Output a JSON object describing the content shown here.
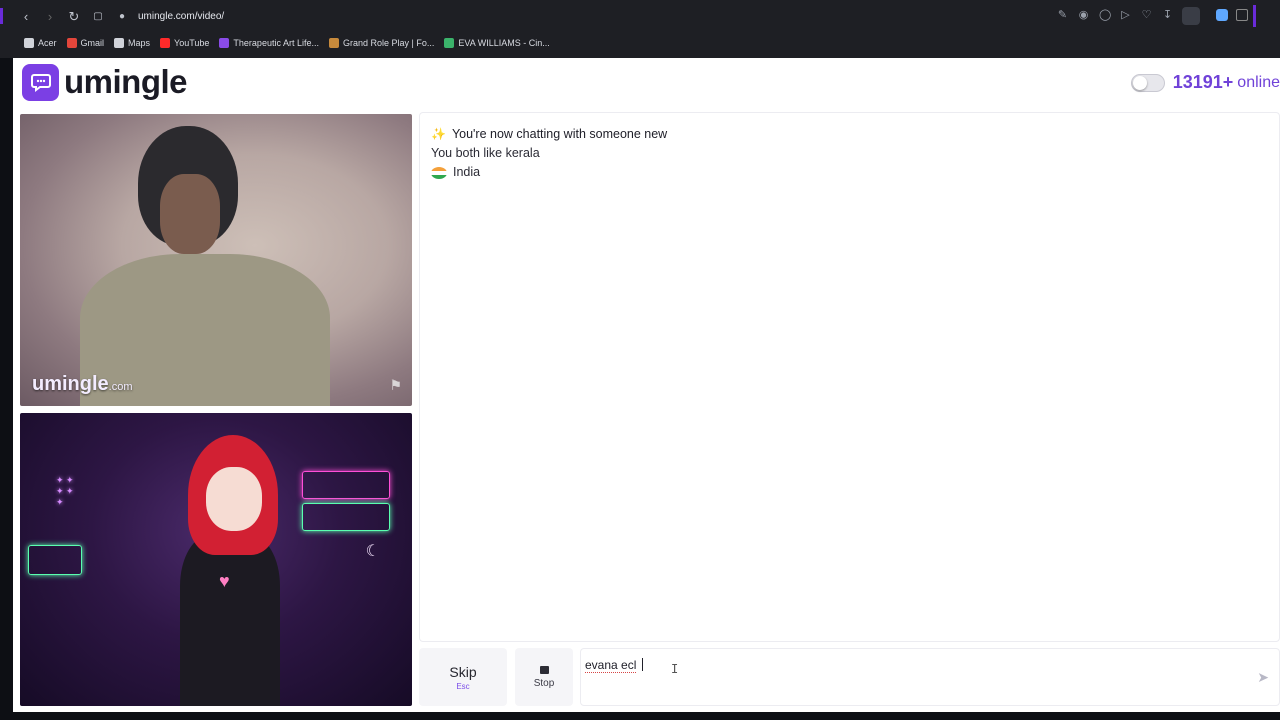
{
  "browser": {
    "url": "umingle.com/video/",
    "bookmarks": [
      {
        "label": "Acer",
        "color": "#d0d3da"
      },
      {
        "label": "Gmail",
        "color": "#e3463b"
      },
      {
        "label": "Maps",
        "color": "#d0d3da"
      },
      {
        "label": "YouTube",
        "color": "#ff2a2a"
      },
      {
        "label": "Therapeutic Art Life...",
        "color": "#8a4be8"
      },
      {
        "label": "Grand Role Play | Fo...",
        "color": "#c78a3c"
      },
      {
        "label": "EVA WILLIAMS - Cin...",
        "color": "#3bb36b"
      }
    ]
  },
  "site": {
    "logo_text": "umingle",
    "online_count": "13191+",
    "online_label": "online",
    "accent_color": "#7042d8"
  },
  "video": {
    "stranger_watermark": "umingle",
    "stranger_watermark_suffix": ".com"
  },
  "chat": {
    "status_line": "You're now chatting with someone new",
    "interest_line": "You both like kerala",
    "country": "India"
  },
  "controls": {
    "skip_label": "Skip",
    "skip_key": "Esc",
    "stop_label": "Stop",
    "message_value": "evana ecl"
  }
}
